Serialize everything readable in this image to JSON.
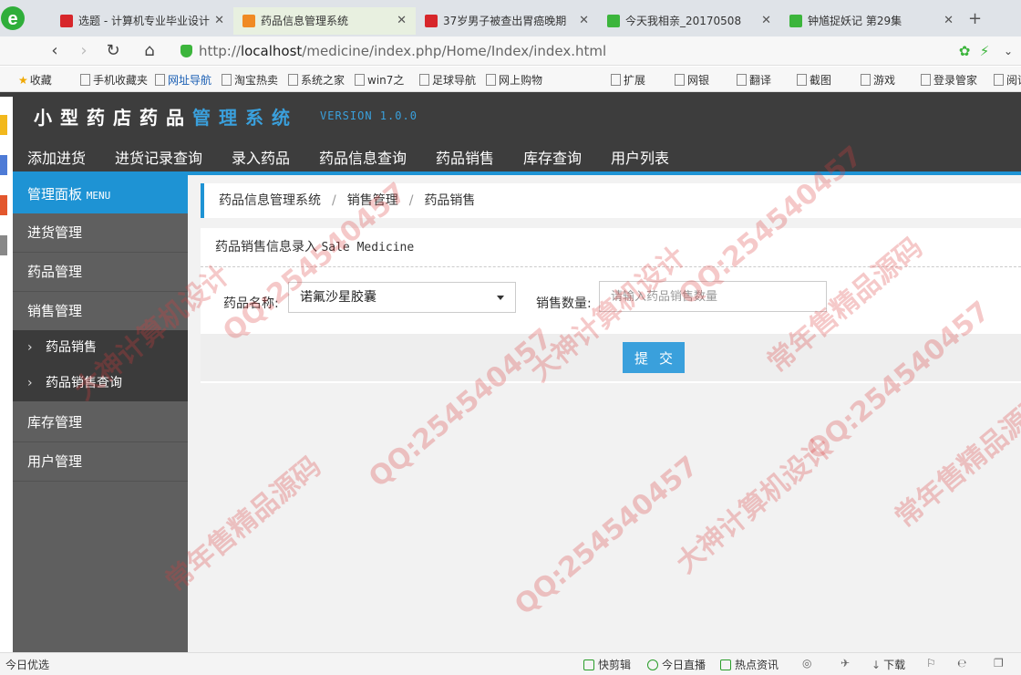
{
  "browser": {
    "tabs": [
      {
        "label": "选题 - 计算机专业毕业设计",
        "icon_color": "#d7262b",
        "active": false
      },
      {
        "label": "药品信息管理系统",
        "icon_color": "#f08a24",
        "active": true
      },
      {
        "label": "37岁男子被查出胃癌晚期",
        "icon_color": "#d7262b",
        "active": false
      },
      {
        "label": "今天我相亲_20170508",
        "icon_color": "#3cb53c",
        "active": false
      },
      {
        "label": "钟馗捉妖记 第29集",
        "icon_color": "#3cb53c",
        "active": false
      }
    ],
    "url_prefix": "http://",
    "url_host": "localhost",
    "url_path": "/medicine/index.php/Home/Index/index.html",
    "bookmarks": [
      "收藏",
      "手机收藏夹",
      "网址导航",
      "淘宝热卖",
      "系统之家",
      "win7之",
      "足球导航",
      "网上购物",
      "扩展",
      "网银",
      "翻译",
      "截图",
      "游戏",
      "登录管家",
      "阅读"
    ]
  },
  "app": {
    "title_main": "小型药店药品",
    "title_accent": "管理系统",
    "version": "VERSION 1.0.0",
    "accent_color": "#1e93d4",
    "top_nav": [
      "添加进货",
      "进货记录查询",
      "录入药品",
      "药品信息查询",
      "药品销售",
      "库存查询",
      "用户列表"
    ]
  },
  "sidebar": {
    "head": "管理面板",
    "head_en": "MENU",
    "items": [
      "进货管理",
      "药品管理",
      "销售管理"
    ],
    "sub_items": [
      "药品销售",
      "药品销售查询"
    ],
    "items_after": [
      "库存管理",
      "用户管理"
    ]
  },
  "breadcrumb": [
    "药品信息管理系统",
    "销售管理",
    "药品销售"
  ],
  "form": {
    "title": "药品销售信息录入",
    "title_en": "Sale Medicine",
    "name_label": "药品名称:",
    "name_value": "诺氟沙星胶囊",
    "qty_label": "销售数量:",
    "qty_placeholder": "请输入药品销售数量",
    "submit_label": "提交"
  },
  "statusbar": {
    "left": "今日优选",
    "right": [
      "快剪辑",
      "今日直播",
      "热点资讯",
      "下载"
    ]
  },
  "watermark": [
    "QQ:254540457",
    "大神计算机设计",
    "常年售精品源码"
  ]
}
